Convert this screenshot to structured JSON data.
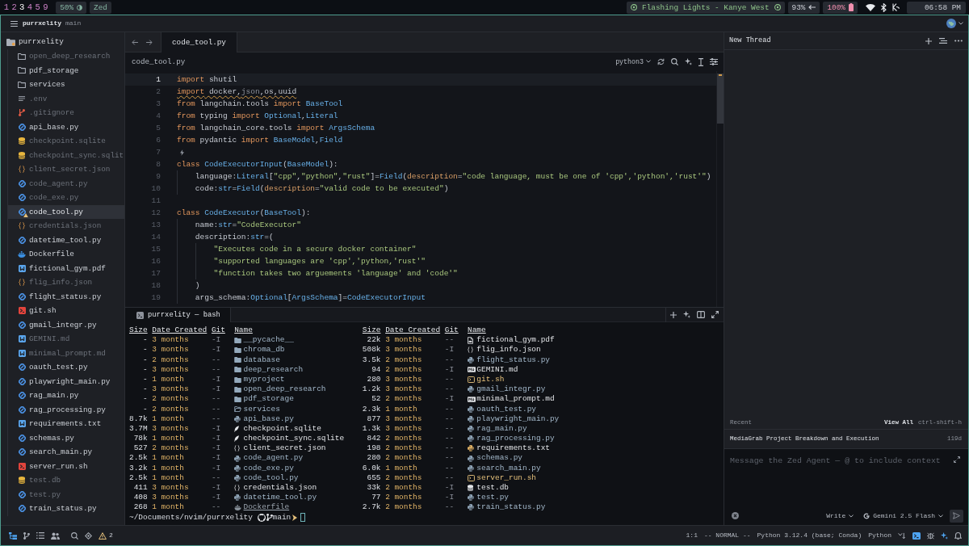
{
  "system_bar": {
    "workspaces": [
      {
        "label": "1",
        "selected": false
      },
      {
        "label": "2",
        "selected": false
      },
      {
        "label": "3",
        "selected": true
      },
      {
        "label": "4",
        "selected": false
      },
      {
        "label": "5",
        "selected": false
      },
      {
        "label": "9",
        "selected": false
      }
    ],
    "brightness": "50%",
    "window": "Zed",
    "now_playing": "Flashing Lights - Kanye West",
    "volume": "93%",
    "battery": "100%",
    "clock": "06:58 PM"
  },
  "title_bar": {
    "project": "purrxelity",
    "branch": "main"
  },
  "project_panel": {
    "root": "purrxelity",
    "items": [
      {
        "label": "open_deep_research",
        "kind": "folder",
        "ignored": true,
        "selected": false,
        "warning": false
      },
      {
        "label": "pdf_storage",
        "kind": "folder",
        "ignored": false,
        "selected": false,
        "warning": false
      },
      {
        "label": "services",
        "kind": "folder",
        "ignored": false,
        "selected": false,
        "warning": false
      },
      {
        "label": ".env",
        "kind": "env",
        "ignored": true,
        "selected": false,
        "warning": false
      },
      {
        "label": ".gitignore",
        "kind": "gitignore",
        "ignored": true,
        "selected": false,
        "warning": false
      },
      {
        "label": "api_base.py",
        "kind": "python",
        "ignored": false,
        "selected": false,
        "warning": false
      },
      {
        "label": "checkpoint.sqlite",
        "kind": "database",
        "ignored": true,
        "selected": false,
        "warning": false
      },
      {
        "label": "checkpoint_sync.sqlit",
        "kind": "database",
        "ignored": true,
        "selected": false,
        "warning": false
      },
      {
        "label": "client_secret.json",
        "kind": "json",
        "ignored": true,
        "selected": false,
        "warning": false
      },
      {
        "label": "code_agent.py",
        "kind": "python",
        "ignored": true,
        "selected": false,
        "warning": false
      },
      {
        "label": "code_exe.py",
        "kind": "python",
        "ignored": true,
        "selected": false,
        "warning": false
      },
      {
        "label": "code_tool.py",
        "kind": "python",
        "ignored": false,
        "selected": true,
        "warning": true
      },
      {
        "label": "credentials.json",
        "kind": "json",
        "ignored": true,
        "selected": false,
        "warning": false
      },
      {
        "label": "datetime_tool.py",
        "kind": "python",
        "ignored": false,
        "selected": false,
        "warning": false
      },
      {
        "label": "Dockerfile",
        "kind": "docker",
        "ignored": false,
        "selected": false,
        "warning": false
      },
      {
        "label": "fictional_gym.pdf",
        "kind": "document",
        "ignored": false,
        "selected": false,
        "warning": false
      },
      {
        "label": "flig_info.json",
        "kind": "json",
        "ignored": true,
        "selected": false,
        "warning": false
      },
      {
        "label": "flight_status.py",
        "kind": "python",
        "ignored": false,
        "selected": false,
        "warning": false
      },
      {
        "label": "git.sh",
        "kind": "shell",
        "ignored": false,
        "selected": false,
        "warning": false
      },
      {
        "label": "gmail_integr.py",
        "kind": "python",
        "ignored": false,
        "selected": false,
        "warning": false
      },
      {
        "label": "GEMINI.md",
        "kind": "document",
        "ignored": true,
        "selected": false,
        "warning": false
      },
      {
        "label": "minimal_prompt.md",
        "kind": "document",
        "ignored": true,
        "selected": false,
        "warning": false
      },
      {
        "label": "oauth_test.py",
        "kind": "python",
        "ignored": false,
        "selected": false,
        "warning": false
      },
      {
        "label": "playwright_main.py",
        "kind": "python",
        "ignored": false,
        "selected": false,
        "warning": false
      },
      {
        "label": "rag_main.py",
        "kind": "python",
        "ignored": false,
        "selected": false,
        "warning": false
      },
      {
        "label": "rag_processing.py",
        "kind": "python",
        "ignored": false,
        "selected": false,
        "warning": false
      },
      {
        "label": "requirements.txt",
        "kind": "document",
        "ignored": false,
        "selected": false,
        "warning": false
      },
      {
        "label": "schemas.py",
        "kind": "python",
        "ignored": false,
        "selected": false,
        "warning": false
      },
      {
        "label": "search_main.py",
        "kind": "python",
        "ignored": false,
        "selected": false,
        "warning": false
      },
      {
        "label": "server_run.sh",
        "kind": "shell",
        "ignored": false,
        "selected": false,
        "warning": false
      },
      {
        "label": "test.db",
        "kind": "database",
        "ignored": true,
        "selected": false,
        "warning": false
      },
      {
        "label": "test.py",
        "kind": "python",
        "ignored": true,
        "selected": false,
        "warning": false
      },
      {
        "label": "train_status.py",
        "kind": "python",
        "ignored": false,
        "selected": false,
        "warning": false
      }
    ]
  },
  "editor": {
    "tabs": [
      {
        "label": "code_tool.py",
        "selected": true
      }
    ],
    "breadcrumb": "code_tool.py",
    "kernel": "python3",
    "lines": [
      {
        "number": "1",
        "kind": "code",
        "selected": true,
        "squiggle": false,
        "tokens": [
          {
            "kind": "keyword",
            "text": "import"
          },
          {
            "kind": "plain",
            "text": " shutil"
          }
        ]
      },
      {
        "number": "2",
        "kind": "code",
        "selected": false,
        "squiggle": true,
        "tokens": [
          {
            "kind": "keyword",
            "text": "import"
          },
          {
            "kind": "plain",
            "text": " docker,"
          },
          {
            "kind": "muted",
            "text": "json"
          },
          {
            "kind": "plain",
            "text": ",os,uuid"
          }
        ]
      },
      {
        "number": "3",
        "kind": "code",
        "selected": false,
        "squiggle": false,
        "tokens": [
          {
            "kind": "keyword",
            "text": "from"
          },
          {
            "kind": "plain",
            "text": " langchain.tools "
          },
          {
            "kind": "keyword",
            "text": "import "
          },
          {
            "kind": "type",
            "text": "BaseTool"
          }
        ]
      },
      {
        "number": "4",
        "kind": "code",
        "selected": false,
        "squiggle": false,
        "tokens": [
          {
            "kind": "keyword",
            "text": "from"
          },
          {
            "kind": "plain",
            "text": " typing "
          },
          {
            "kind": "keyword",
            "text": "import "
          },
          {
            "kind": "type",
            "text": "Optional"
          },
          {
            "kind": "plain",
            "text": ","
          },
          {
            "kind": "type",
            "text": "Literal"
          }
        ]
      },
      {
        "number": "5",
        "kind": "code",
        "selected": false,
        "squiggle": false,
        "tokens": [
          {
            "kind": "keyword",
            "text": "from"
          },
          {
            "kind": "plain",
            "text": " langchain_core.tools "
          },
          {
            "kind": "keyword",
            "text": "import "
          },
          {
            "kind": "type",
            "text": "ArgsSchema"
          }
        ]
      },
      {
        "number": "6",
        "kind": "code",
        "selected": false,
        "squiggle": false,
        "tokens": [
          {
            "kind": "keyword",
            "text": "from"
          },
          {
            "kind": "plain",
            "text": " pydantic "
          },
          {
            "kind": "keyword",
            "text": "import "
          },
          {
            "kind": "type",
            "text": "BaseModel"
          },
          {
            "kind": "plain",
            "text": ","
          },
          {
            "kind": "type",
            "text": "Field"
          }
        ]
      },
      {
        "number": "7",
        "kind": "hint",
        "selected": false
      },
      {
        "number": "8",
        "kind": "code",
        "selected": false,
        "squiggle": false,
        "tokens": [
          {
            "kind": "keyword",
            "text": "class "
          },
          {
            "kind": "type",
            "text": "CodeExecutorInput"
          },
          {
            "kind": "plain",
            "text": "("
          },
          {
            "kind": "type",
            "text": "BaseModel"
          },
          {
            "kind": "plain",
            "text": "):"
          }
        ]
      },
      {
        "number": "9",
        "kind": "code",
        "selected": false,
        "squiggle": false,
        "tokens": [
          {
            "kind": "plain",
            "text": "    language:"
          },
          {
            "kind": "type",
            "text": "Literal"
          },
          {
            "kind": "plain",
            "text": "["
          },
          {
            "kind": "string",
            "text": "\"cpp\""
          },
          {
            "kind": "plain",
            "text": ","
          },
          {
            "kind": "string",
            "text": "\"python\""
          },
          {
            "kind": "plain",
            "text": ","
          },
          {
            "kind": "string",
            "text": "\"rust\""
          },
          {
            "kind": "plain",
            "text": "]="
          },
          {
            "kind": "type",
            "text": "Field"
          },
          {
            "kind": "plain",
            "text": "("
          },
          {
            "kind": "param",
            "text": "description"
          },
          {
            "kind": "plain",
            "text": "="
          },
          {
            "kind": "string",
            "text": "\"code language, must be one of 'cpp','python','rust'\""
          },
          {
            "kind": "plain",
            "text": ")"
          }
        ]
      },
      {
        "number": "10",
        "kind": "code",
        "selected": false,
        "squiggle": false,
        "tokens": [
          {
            "kind": "plain",
            "text": "    code:"
          },
          {
            "kind": "type",
            "text": "str"
          },
          {
            "kind": "plain",
            "text": "="
          },
          {
            "kind": "type",
            "text": "Field"
          },
          {
            "kind": "plain",
            "text": "("
          },
          {
            "kind": "param",
            "text": "description"
          },
          {
            "kind": "plain",
            "text": "="
          },
          {
            "kind": "string",
            "text": "\"valid code to be executed\""
          },
          {
            "kind": "plain",
            "text": ")"
          }
        ]
      },
      {
        "number": "11",
        "kind": "blank",
        "selected": false
      },
      {
        "number": "12",
        "kind": "code",
        "selected": false,
        "squiggle": false,
        "tokens": [
          {
            "kind": "keyword",
            "text": "class "
          },
          {
            "kind": "type",
            "text": "CodeExecutor"
          },
          {
            "kind": "plain",
            "text": "("
          },
          {
            "kind": "type",
            "text": "BaseTool"
          },
          {
            "kind": "plain",
            "text": "):"
          }
        ]
      },
      {
        "number": "13",
        "kind": "code",
        "selected": false,
        "squiggle": false,
        "tokens": [
          {
            "kind": "plain",
            "text": "    name:"
          },
          {
            "kind": "type",
            "text": "str"
          },
          {
            "kind": "plain",
            "text": "="
          },
          {
            "kind": "string",
            "text": "\"CodeExecutor\""
          }
        ]
      },
      {
        "number": "14",
        "kind": "code",
        "selected": false,
        "squiggle": false,
        "tokens": [
          {
            "kind": "plain",
            "text": "    description:"
          },
          {
            "kind": "type",
            "text": "str"
          },
          {
            "kind": "plain",
            "text": "=("
          }
        ]
      },
      {
        "number": "15",
        "kind": "code",
        "selected": false,
        "squiggle": false,
        "tokens": [
          {
            "kind": "string",
            "text": "        \"Executes code in a secure docker container\""
          }
        ]
      },
      {
        "number": "16",
        "kind": "code",
        "selected": false,
        "squiggle": false,
        "tokens": [
          {
            "kind": "string",
            "text": "        \"supported languages are 'cpp','python,'rust'\""
          }
        ]
      },
      {
        "number": "17",
        "kind": "code",
        "selected": false,
        "squiggle": false,
        "tokens": [
          {
            "kind": "string",
            "text": "        \"function takes two arguements 'language' and 'code'\""
          }
        ]
      },
      {
        "number": "18",
        "kind": "code",
        "selected": false,
        "squiggle": false,
        "tokens": [
          {
            "kind": "plain",
            "text": "    )"
          }
        ]
      },
      {
        "number": "19",
        "kind": "code",
        "selected": false,
        "squiggle": false,
        "tokens": [
          {
            "kind": "plain",
            "text": "    args_schema:"
          },
          {
            "kind": "type",
            "text": "Optional"
          },
          {
            "kind": "plain",
            "text": "["
          },
          {
            "kind": "type",
            "text": "ArgsSchema"
          },
          {
            "kind": "plain",
            "text": "]="
          },
          {
            "kind": "type",
            "text": "CodeExecutorInput"
          }
        ]
      }
    ]
  },
  "terminal": {
    "tabs": [
      {
        "label": "purrxelity — bash",
        "selected": true
      }
    ],
    "listing": [
      {
        "headers": [
          "Size",
          "Date Created",
          "Git",
          "Name"
        ],
        "rows": [
          {
            "size": "-",
            "date": "3 months",
            "git": "-I",
            "name": "__pycache__",
            "kind": "folder"
          },
          {
            "size": "-",
            "date": "3 months",
            "git": "-I",
            "name": "chroma_db",
            "kind": "folder"
          },
          {
            "size": "-",
            "date": "2 months",
            "git": "--",
            "name": "database",
            "kind": "folder"
          },
          {
            "size": "-",
            "date": "3 months",
            "git": "--",
            "name": "deep_research",
            "kind": "folder"
          },
          {
            "size": "-",
            "date": "1 month",
            "git": "-I",
            "name": "myproject",
            "kind": "folder"
          },
          {
            "size": "-",
            "date": "3 months",
            "git": "-I",
            "name": "open_deep_research",
            "kind": "folder"
          },
          {
            "size": "-",
            "date": "2 months",
            "git": "--",
            "name": "pdf_storage",
            "kind": "folder"
          },
          {
            "size": "-",
            "date": "2 months",
            "git": "--",
            "name": "services",
            "kind": "openfolder"
          },
          {
            "size": "8.7k",
            "date": "1 month",
            "git": "--",
            "name": "api_base.py",
            "kind": "python"
          },
          {
            "size": "3.7M",
            "date": "3 months",
            "git": "-I",
            "name": "checkpoint.sqlite",
            "kind": "sqlite"
          },
          {
            "size": "78k",
            "date": "1 month",
            "git": "-I",
            "name": "checkpoint_sync.sqlite",
            "kind": "sqlite"
          },
          {
            "size": "527",
            "date": "2 months",
            "git": "-I",
            "name": "client_secret.json",
            "kind": "json"
          },
          {
            "size": "2.5k",
            "date": "1 month",
            "git": "-I",
            "name": "code_agent.py",
            "kind": "python"
          },
          {
            "size": "3.2k",
            "date": "1 month",
            "git": "-I",
            "name": "code_exe.py",
            "kind": "python"
          },
          {
            "size": "2.5k",
            "date": "1 month",
            "git": "--",
            "name": "code_tool.py",
            "kind": "python"
          },
          {
            "size": "411",
            "date": "3 months",
            "git": "-I",
            "name": "credentials.json",
            "kind": "json"
          },
          {
            "size": "408",
            "date": "3 months",
            "git": "-I",
            "name": "datetime_tool.py",
            "kind": "python"
          },
          {
            "size": "268",
            "date": "1 month",
            "git": "--",
            "name": "Dockerfile",
            "kind": "docker"
          }
        ]
      },
      {
        "headers": [
          "Size",
          "Date Created",
          "Git",
          "Name"
        ],
        "rows": [
          {
            "size": "22k",
            "date": "3 months",
            "git": "--",
            "name": "fictional_gym.pdf",
            "kind": "pdf"
          },
          {
            "size": "508k",
            "date": "3 months",
            "git": "-I",
            "name": "flig_info.json",
            "kind": "json"
          },
          {
            "size": "3.5k",
            "date": "2 months",
            "git": "--",
            "name": "flight_status.py",
            "kind": "python"
          },
          {
            "size": "94",
            "date": "2 months",
            "git": "-I",
            "name": "GEMINI.md",
            "kind": "markdown"
          },
          {
            "size": "280",
            "date": "3 months",
            "git": "--",
            "name": "git.sh",
            "kind": "shell"
          },
          {
            "size": "1.2k",
            "date": "3 months",
            "git": "--",
            "name": "gmail_integr.py",
            "kind": "python"
          },
          {
            "size": "52",
            "date": "2 months",
            "git": "-I",
            "name": "minimal_prompt.md",
            "kind": "markdown"
          },
          {
            "size": "2.3k",
            "date": "1 month",
            "git": "--",
            "name": "oauth_test.py",
            "kind": "python"
          },
          {
            "size": "877",
            "date": "3 months",
            "git": "--",
            "name": "playwright_main.py",
            "kind": "python"
          },
          {
            "size": "1.3k",
            "date": "3 months",
            "git": "--",
            "name": "rag_main.py",
            "kind": "python"
          },
          {
            "size": "842",
            "date": "2 months",
            "git": "--",
            "name": "rag_processing.py",
            "kind": "python"
          },
          {
            "size": "198",
            "date": "2 months",
            "git": "--",
            "name": "requirements.txt",
            "kind": "text"
          },
          {
            "size": "280",
            "date": "2 months",
            "git": "--",
            "name": "schemas.py",
            "kind": "python"
          },
          {
            "size": "6.0k",
            "date": "1 month",
            "git": "--",
            "name": "search_main.py",
            "kind": "python"
          },
          {
            "size": "655",
            "date": "2 months",
            "git": "--",
            "name": "server_run.sh",
            "kind": "shell"
          },
          {
            "size": "33k",
            "date": "2 months",
            "git": "-I",
            "name": "test.db",
            "kind": "database"
          },
          {
            "size": "77",
            "date": "2 months",
            "git": "-I",
            "name": "test.py",
            "kind": "python"
          },
          {
            "size": "2.7k",
            "date": "2 months",
            "git": "--",
            "name": "train_status.py",
            "kind": "python"
          }
        ]
      }
    ],
    "prompt": {
      "path": "~/Documents/nvim/purrxelity",
      "branch": "main"
    }
  },
  "agent_panel": {
    "title": "New Thread",
    "recent_label": "Recent",
    "view_all": "View All",
    "shortcut": "ctrl-shift-h",
    "threads": [
      {
        "title": "MediaGrab Project Breakdown and Execution",
        "age": "119d"
      }
    ],
    "message": {
      "placeholder": "Message the Zed Agent — @ to include context"
    },
    "mode": "Write",
    "model": "Gemini 2.5 Flash"
  },
  "status_bar": {
    "left_buttons": [
      {
        "kind": "files",
        "selected": true
      },
      {
        "kind": "git",
        "selected": false
      },
      {
        "kind": "outline",
        "selected": false
      },
      {
        "kind": "collab",
        "selected": false
      },
      {
        "kind": "search",
        "selected": false
      },
      {
        "kind": "debug",
        "selected": false
      }
    ],
    "warnings": "2",
    "cursor_position": "1:1",
    "vim_mode": "-- NORMAL --",
    "interpreter": "Python 3.12.4 (base; Conda)",
    "language": "Python",
    "right_buttons": [
      {
        "kind": "prediction",
        "selected": false
      },
      {
        "kind": "terminal",
        "selected": true
      },
      {
        "kind": "debug",
        "selected": false
      },
      {
        "kind": "agent",
        "selected": true
      },
      {
        "kind": "notifications",
        "selected": false
      }
    ]
  }
}
